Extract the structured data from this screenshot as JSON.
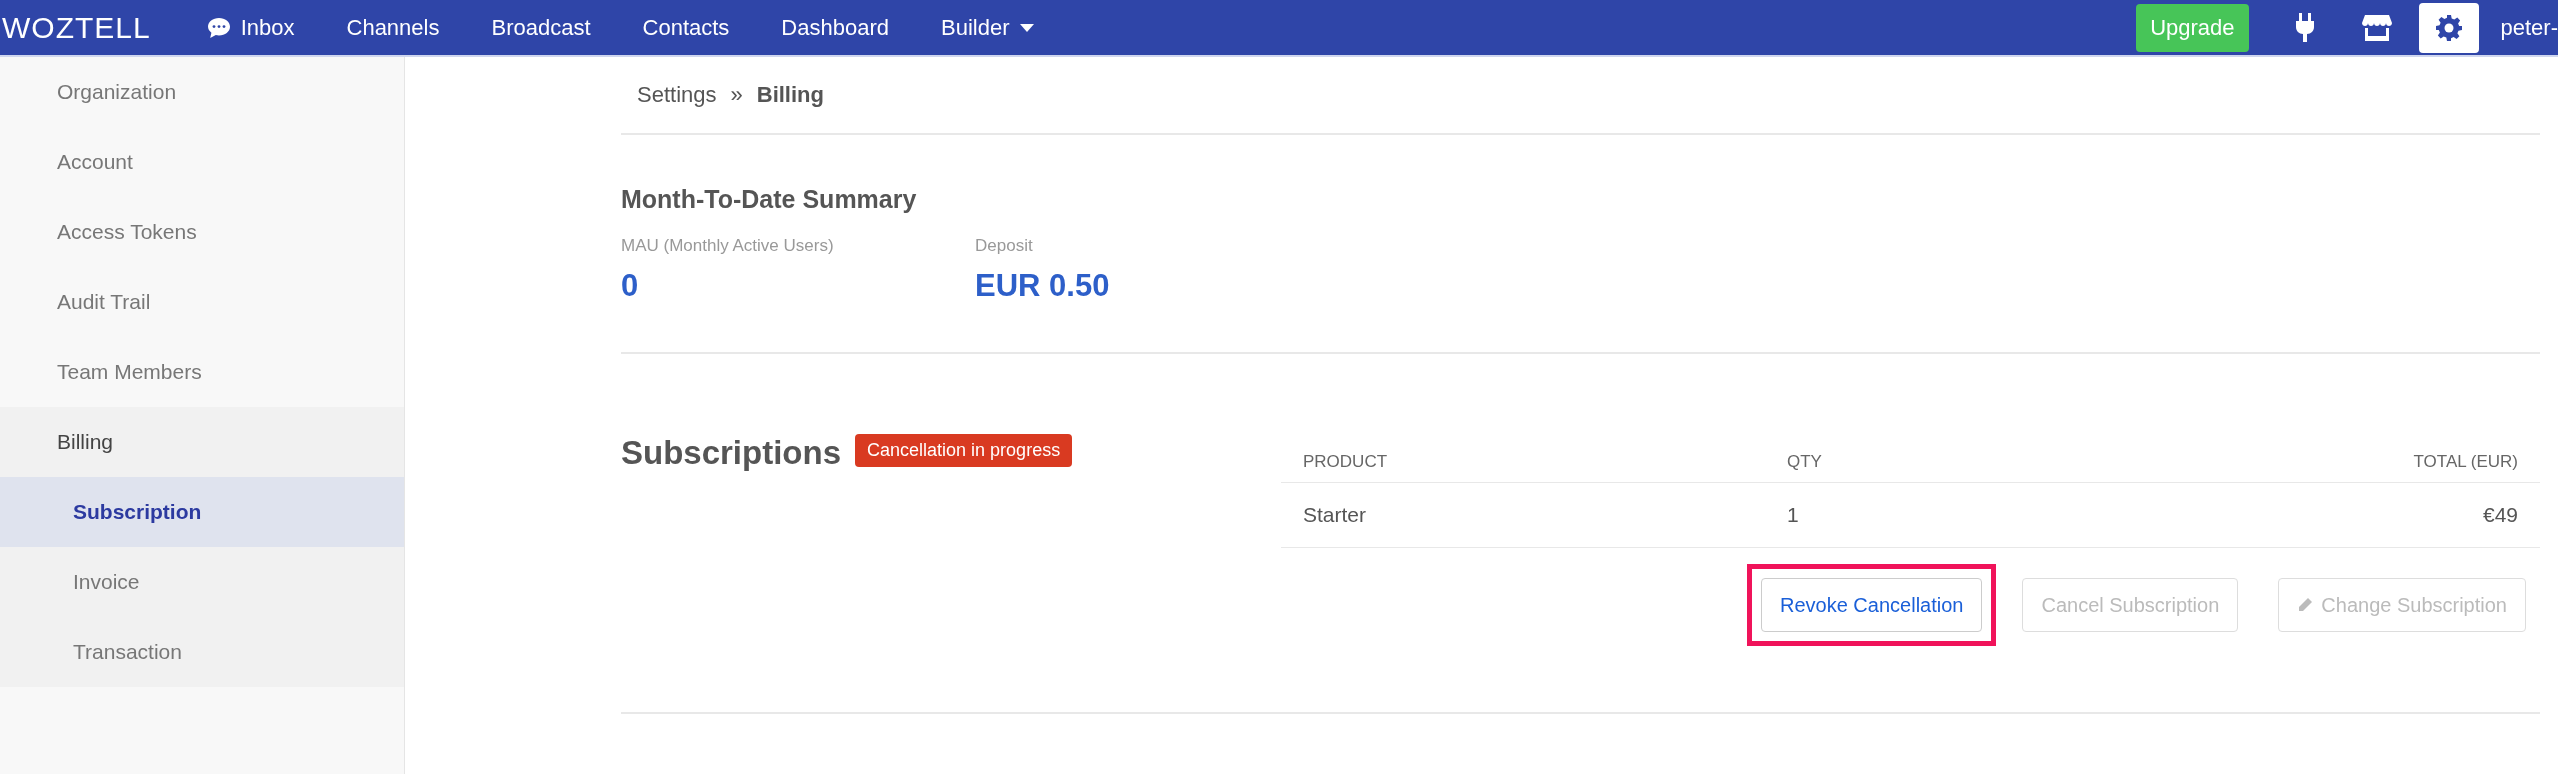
{
  "topbar": {
    "logo": "WOZTELL",
    "nav": [
      {
        "label": "Inbox"
      },
      {
        "label": "Channels"
      },
      {
        "label": "Broadcast"
      },
      {
        "label": "Contacts"
      },
      {
        "label": "Dashboard"
      },
      {
        "label": "Builder",
        "dropdown": true
      }
    ],
    "upgrade": "Upgrade",
    "tools": [
      {
        "selected": false
      },
      {
        "selected": false
      },
      {
        "selected": true
      }
    ],
    "user": "peter-"
  },
  "sidebar": {
    "items": [
      {
        "label": "Organization",
        "selected": false
      },
      {
        "label": "Account",
        "selected": false
      },
      {
        "label": "Access Tokens",
        "selected": false
      },
      {
        "label": "Audit Trail",
        "selected": false
      },
      {
        "label": "Team Members",
        "selected": false
      },
      {
        "label": "Billing",
        "selected": false,
        "expanded": true,
        "children": [
          {
            "label": "Subscription",
            "selected": true
          },
          {
            "label": "Invoice",
            "selected": false
          },
          {
            "label": "Transaction",
            "selected": false
          }
        ]
      }
    ]
  },
  "breadcrumb": {
    "parent": "Settings",
    "separator": "»",
    "current": "Billing"
  },
  "summary": {
    "title": "Month-To-Date Summary",
    "stats": [
      {
        "label": "MAU (Monthly Active Users)",
        "value": "0"
      },
      {
        "label": "Deposit",
        "value": "EUR 0.50"
      }
    ]
  },
  "subscriptions": {
    "title": "Subscriptions",
    "badge": "Cancellation in progress",
    "table": {
      "columns": [
        "PRODUCT",
        "QTY",
        "TOTAL (EUR)"
      ],
      "rows": [
        [
          "Starter",
          "1",
          "€49"
        ]
      ]
    },
    "buttons": [
      {
        "label": "Revoke Cancellation",
        "disabled": false,
        "highlighted": true
      },
      {
        "label": "Cancel Subscription",
        "disabled": true,
        "highlighted": false
      },
      {
        "label": "Change Subscription",
        "disabled": true,
        "highlighted": false
      }
    ]
  }
}
